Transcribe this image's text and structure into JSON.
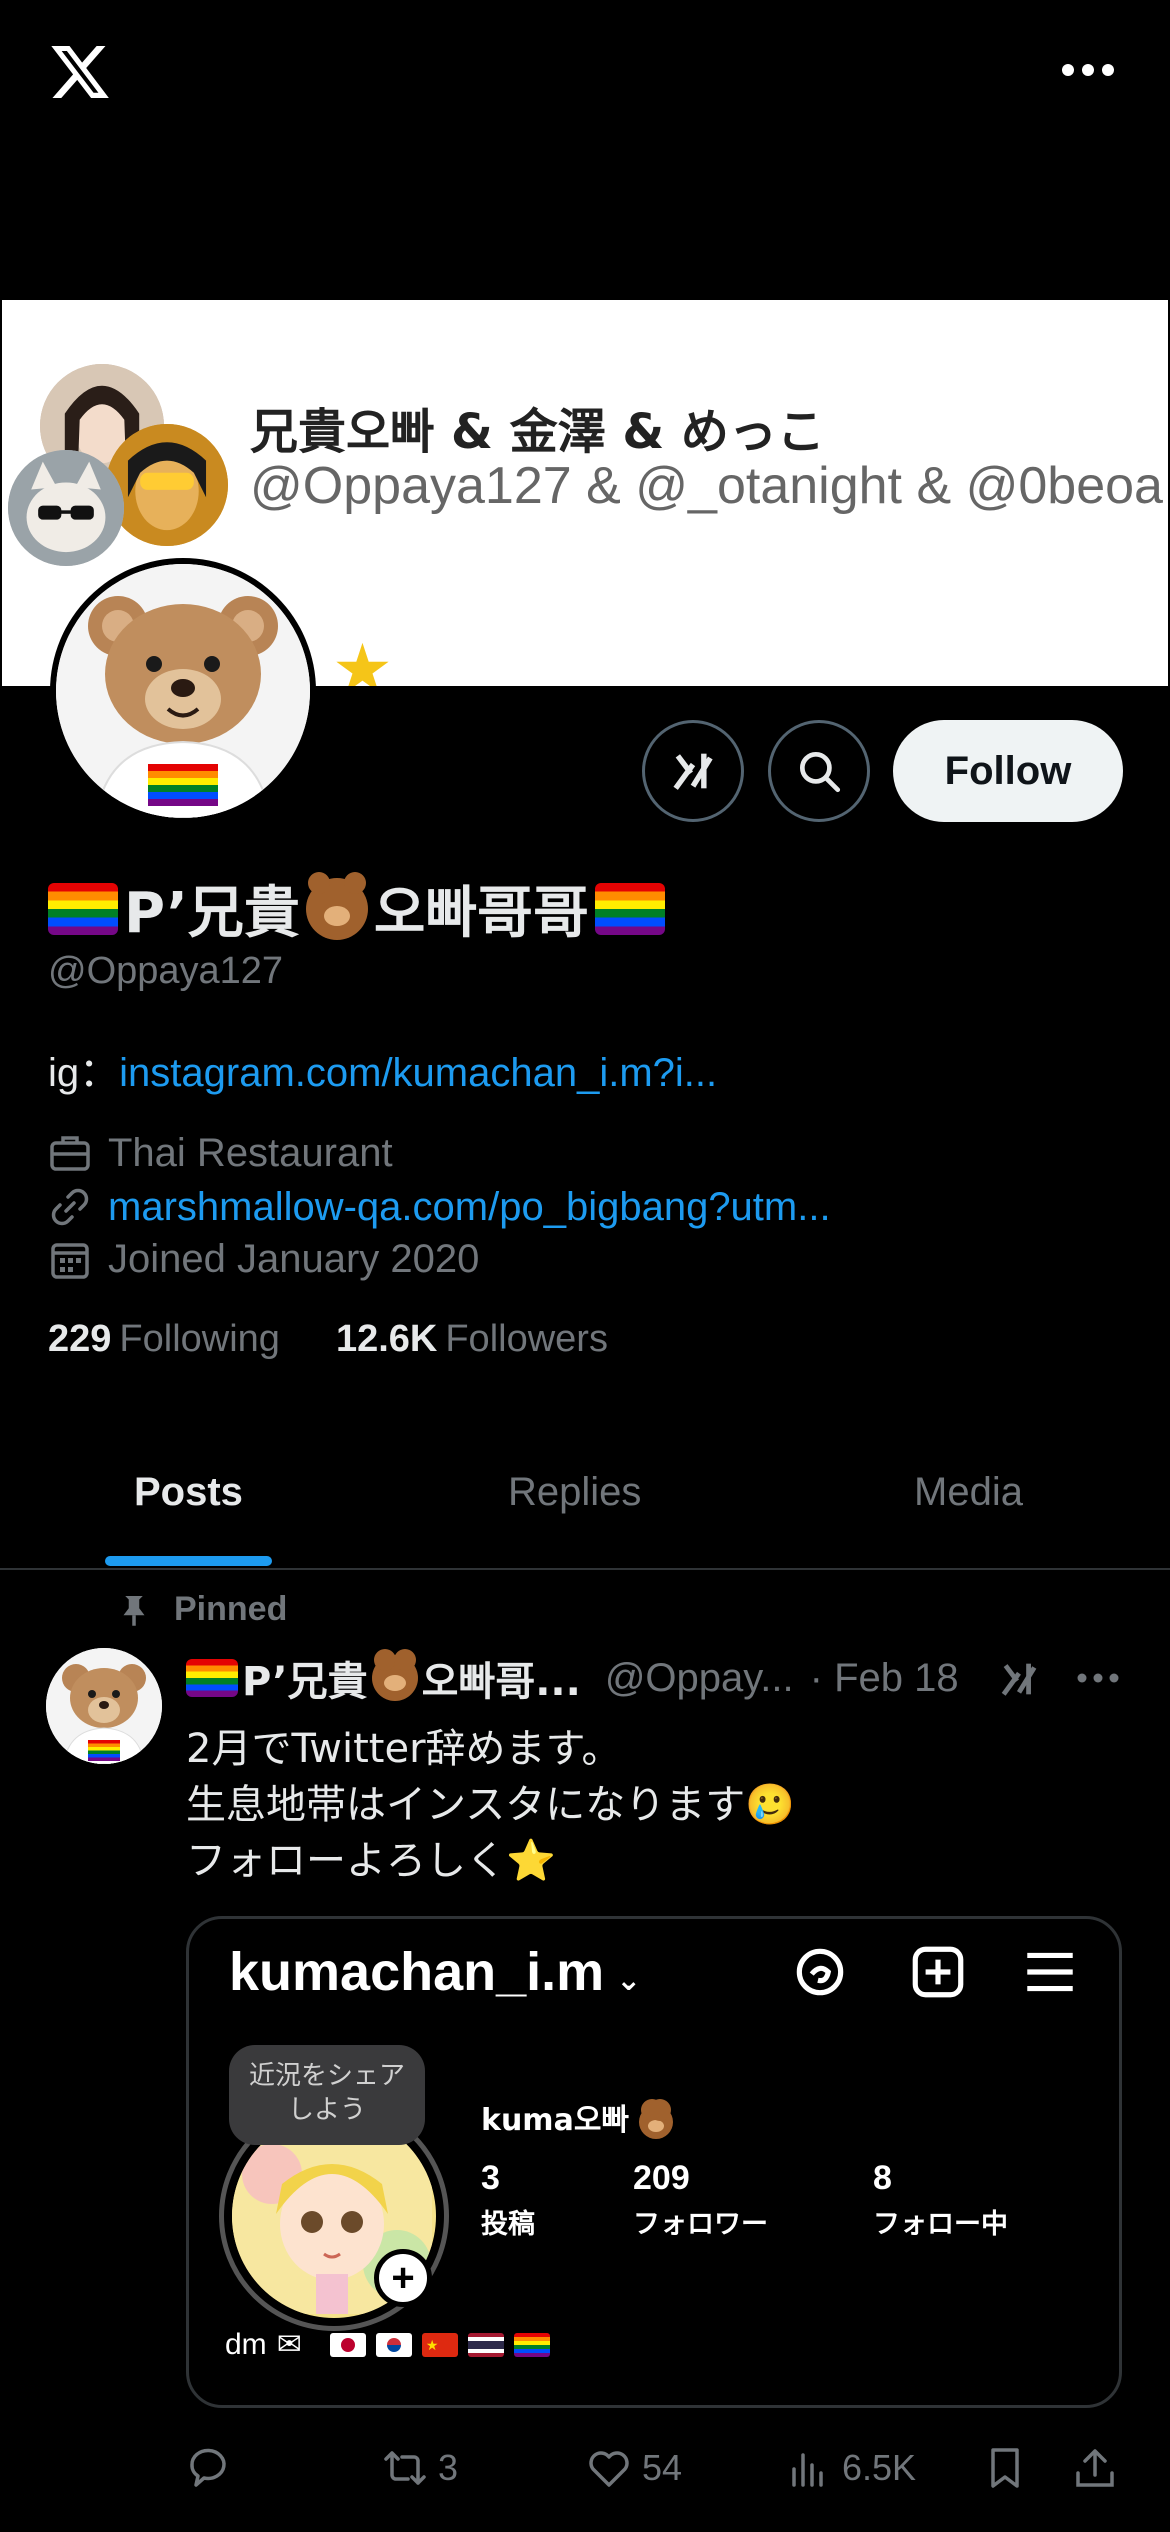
{
  "app": {
    "logo_icon": "x-logo-icon",
    "more_icon": "more-horizontal-icon"
  },
  "banner": {
    "title": "兄貴오빠 & 金澤 & めっこ",
    "handles": "@Oppaya127 & @_otanight & @0beoa"
  },
  "profile": {
    "display_name_start": "P’兄貴",
    "display_name_end": "오빠哥哥",
    "handle": "@Oppaya127",
    "bio_prefix": "ig：",
    "bio_link": "instagram.com/kumachan_i.m?i...",
    "category": "Thai Restaurant",
    "website": "marshmallow-qa.com/po_bigbang?utm...",
    "joined": "Joined January 2020",
    "following_count": "229",
    "following_label": "Following",
    "followers_count": "12.6K",
    "followers_label": "Followers",
    "follow_button": "Follow"
  },
  "tabs": [
    {
      "label": "Posts",
      "active": true
    },
    {
      "label": "Replies",
      "active": false
    },
    {
      "label": "Media",
      "active": false
    }
  ],
  "post": {
    "pinned_label": "Pinned",
    "author_name_start": "P’兄貴",
    "author_name_end": "오빠哥...",
    "author_handle": "@Oppay...",
    "date": "· Feb 18",
    "lines": [
      "2月でTwitter辞めます。",
      "生息地帯はインスタになります",
      "フォローよろしく"
    ],
    "emoji_line2": "🥲",
    "emoji_line3": "⭐",
    "card": {
      "username": "kumachan_i.m",
      "bubble": "近況をシェア\nしよう",
      "name": "kuma오빠",
      "stats": [
        {
          "value": "3",
          "label": "投稿"
        },
        {
          "value": "209",
          "label": "フォロワー"
        },
        {
          "value": "8",
          "label": "フォロー中"
        }
      ],
      "bio": "dm"
    },
    "actions": {
      "replies": "",
      "reposts": "3",
      "likes": "54",
      "views": "6.5K"
    }
  },
  "colors": {
    "background": "#000000",
    "accent": "#1d9bf0",
    "secondary_text": "#71767b",
    "primary_text": "#e7e9ea"
  }
}
